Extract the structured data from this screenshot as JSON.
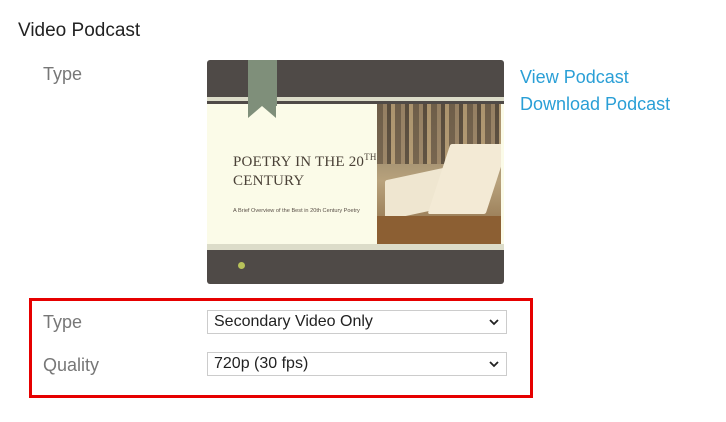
{
  "section": {
    "title": "Video Podcast"
  },
  "preview": {
    "label": "Type",
    "slide_title_line1": "POETRY IN THE 20",
    "slide_title_sup": "TH",
    "slide_title_line2": "CENTURY",
    "slide_subtitle": "A Brief Overview of the Best in 20th Century Poetry"
  },
  "links": {
    "view": "View Podcast",
    "download": "Download Podcast"
  },
  "options": {
    "type_label": "Type",
    "type_value": "Secondary Video Only",
    "quality_label": "Quality",
    "quality_value": "720p (30 fps)"
  },
  "colors": {
    "link": "#2a9fd6",
    "highlight_border": "#e60000",
    "label": "#777777"
  }
}
